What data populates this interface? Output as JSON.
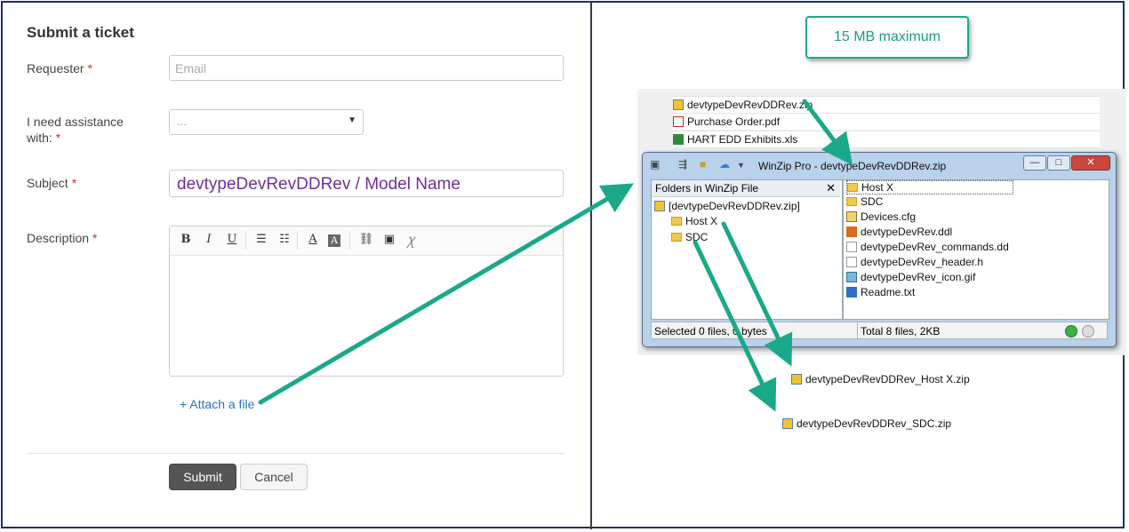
{
  "form": {
    "title": "Submit a ticket",
    "requester_label": "Requester",
    "required_mark": "*",
    "requester_placeholder": "Email",
    "assistance_label_1": "I need assistance",
    "assistance_label_2": "with:",
    "assistance_value": "...",
    "subject_label": "Subject",
    "subject_value": "devtypeDevRevDDRev / Model Name",
    "description_label": "Description",
    "toolbar": {
      "bold": "B",
      "italic": "I",
      "underline": "U",
      "font_color": "A",
      "bg_color": "A"
    },
    "attach_label": "+ Attach a file",
    "submit_label": "Submit",
    "cancel_label": "Cancel"
  },
  "note": {
    "text": "15 MB maximum"
  },
  "explorer": {
    "files": [
      "devtypeDevRevDDRev.zip",
      "Purchase Order.pdf",
      "HART EDD Exhibits.xls"
    ]
  },
  "winzip": {
    "title": "WinZip Pro - devtypeDevRevDDRev.zip",
    "minimize": "—",
    "maximize": "□",
    "close": "✕",
    "folders_header": "Folders in WinZip File",
    "folders_close": "✕",
    "tree": [
      "[devtypeDevRevDDRev.zip]",
      "Host X",
      "SDC"
    ],
    "files": [
      "Host X",
      "SDC",
      "Devices.cfg",
      "devtypeDevRev.ddl",
      "devtypeDevRev_commands.dd",
      "devtypeDevRev_header.h",
      "devtypeDevRev_icon.gif",
      "Readme.txt"
    ],
    "status_left": "Selected 0 files, 0 bytes",
    "status_right": "Total 8 files, 2KB"
  },
  "outputs": [
    "devtypeDevRevDDRev_Host X.zip",
    "devtypeDevRevDDRev_SDC.zip"
  ],
  "colors": {
    "arrow": "#1aa988",
    "subject_text": "#6f2f9a",
    "link": "#2b73b8",
    "border": "#1e2f6b"
  }
}
